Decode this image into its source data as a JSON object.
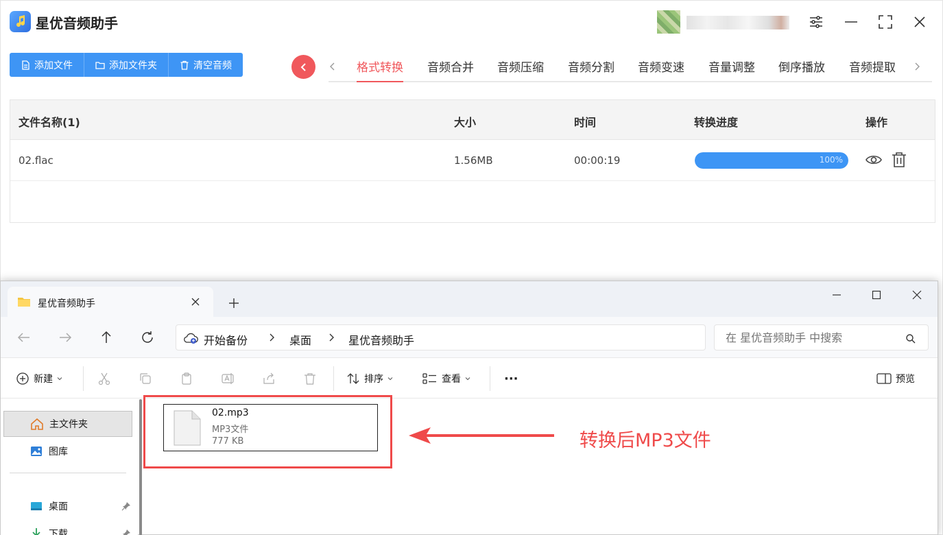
{
  "app": {
    "title": "星优音频助手",
    "toolbar": {
      "add_file": "添加文件",
      "add_folder": "添加文件夹",
      "clear": "清空音频"
    },
    "tabs": [
      "格式转换",
      "音频合并",
      "音频压缩",
      "音频分割",
      "音频变速",
      "音量调整",
      "倒序播放",
      "音频提取"
    ],
    "active_tab": "格式转换",
    "table": {
      "headers": {
        "name": "文件名称(1)",
        "size": "大小",
        "time": "时间",
        "progress": "转换进度",
        "ops": "操作"
      },
      "rows": [
        {
          "name": "02.flac",
          "size": "1.56MB",
          "time": "00:00:19",
          "progress_text": "100%",
          "progress": 1.0
        }
      ]
    },
    "colors": {
      "primary": "#3e95f5",
      "accent": "#f0585c"
    }
  },
  "explorer": {
    "tab_title": "星优音频助手",
    "breadcrumb": [
      "开始备份",
      "桌面",
      "星优音频助手"
    ],
    "search_placeholder": "在 星优音频助手 中搜索",
    "commands": {
      "new": "新建",
      "sort": "排序",
      "view": "查看",
      "more": "···",
      "preview": "预览"
    },
    "sidebar": [
      {
        "label": "主文件夹",
        "icon": "home-icon"
      },
      {
        "label": "图库",
        "icon": "gallery-icon"
      },
      {
        "label": "桌面",
        "icon": "desktop-icon"
      },
      {
        "label": "下载",
        "icon": "download-icon"
      }
    ],
    "file": {
      "name": "02.mp3",
      "type": "MP3文件",
      "size": "777 KB"
    }
  },
  "annotation": {
    "text": "转换后MP3文件",
    "color": "#ef4a4a"
  }
}
